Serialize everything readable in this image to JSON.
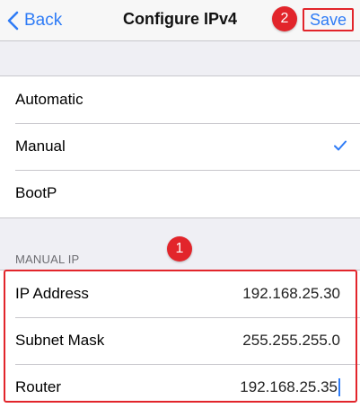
{
  "navbar": {
    "back_label": "Back",
    "title": "Configure IPv4",
    "save_label": "Save"
  },
  "annotations": {
    "badge_1": "1",
    "badge_2": "2",
    "accent_color": "#e2252b"
  },
  "config_options": [
    {
      "label": "Automatic",
      "selected": false
    },
    {
      "label": "Manual",
      "selected": true
    },
    {
      "label": "BootP",
      "selected": false
    }
  ],
  "manual_ip": {
    "section_header": "MANUAL IP",
    "fields": [
      {
        "label": "IP Address",
        "value": "192.168.25.30"
      },
      {
        "label": "Subnet Mask",
        "value": "255.255.255.0"
      },
      {
        "label": "Router",
        "value": "192.168.25.35"
      }
    ]
  },
  "colors": {
    "tint": "#2f7cf6",
    "background": "#efeff4"
  }
}
